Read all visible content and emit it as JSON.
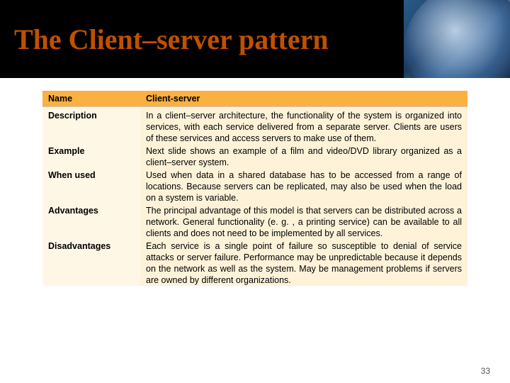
{
  "title": "The Client–server pattern",
  "table": {
    "headers": {
      "col1": "Name",
      "col2": "Client-server"
    },
    "rows": [
      {
        "label": "Description",
        "value": "In a client–server architecture, the functionality of the system is organized into services, with each service delivered from a separate server. Clients are users of these services and access servers to make use of them."
      },
      {
        "label": "Example",
        "value": "Next slide shows an example of a film and video/DVD library organized as a client–server system."
      },
      {
        "label": "When used",
        "value": "Used when data in a shared database has to be accessed from a range of locations. Because servers can be replicated, may also be used when the load on a system is variable."
      },
      {
        "label": "Advantages",
        "value": "The principal advantage of this model is that servers can be distributed across a network. General functionality (e. g. , a printing service) can be available to all clients and does not need to be implemented by all services."
      },
      {
        "label": "Disadvantages",
        "value": "Each service is a single point of failure so susceptible to denial of service attacks or server failure. Performance may be unpredictable because it depends on the network as well as the system. May be management problems if servers are owned by different organizations."
      }
    ]
  },
  "page_number": "33"
}
